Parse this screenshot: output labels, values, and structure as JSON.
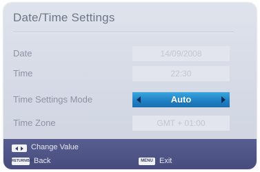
{
  "title": "Date/Time Settings",
  "rows": [
    {
      "label": "Date",
      "value": "14/09/2008",
      "selected": false
    },
    {
      "label": "Time",
      "value": "22:30",
      "selected": false
    },
    {
      "label": "Time Settings Mode",
      "value": "Auto",
      "selected": true
    },
    {
      "label": "Time Zone",
      "value": "GMT + 01:00",
      "selected": false
    }
  ],
  "footer": {
    "change_value": "Change Value",
    "back_key": "RETURN/BACK",
    "back": "Back",
    "menu_key": "MENU",
    "exit": "Exit"
  },
  "colors": {
    "panel": "#d8dce6",
    "selected": "#2a8fd0",
    "footer": "#50568a"
  },
  "icons": {
    "change_value": "left-right-arrows-icon",
    "selector_left": "triangle-left-icon",
    "selector_right": "triangle-right-icon"
  }
}
